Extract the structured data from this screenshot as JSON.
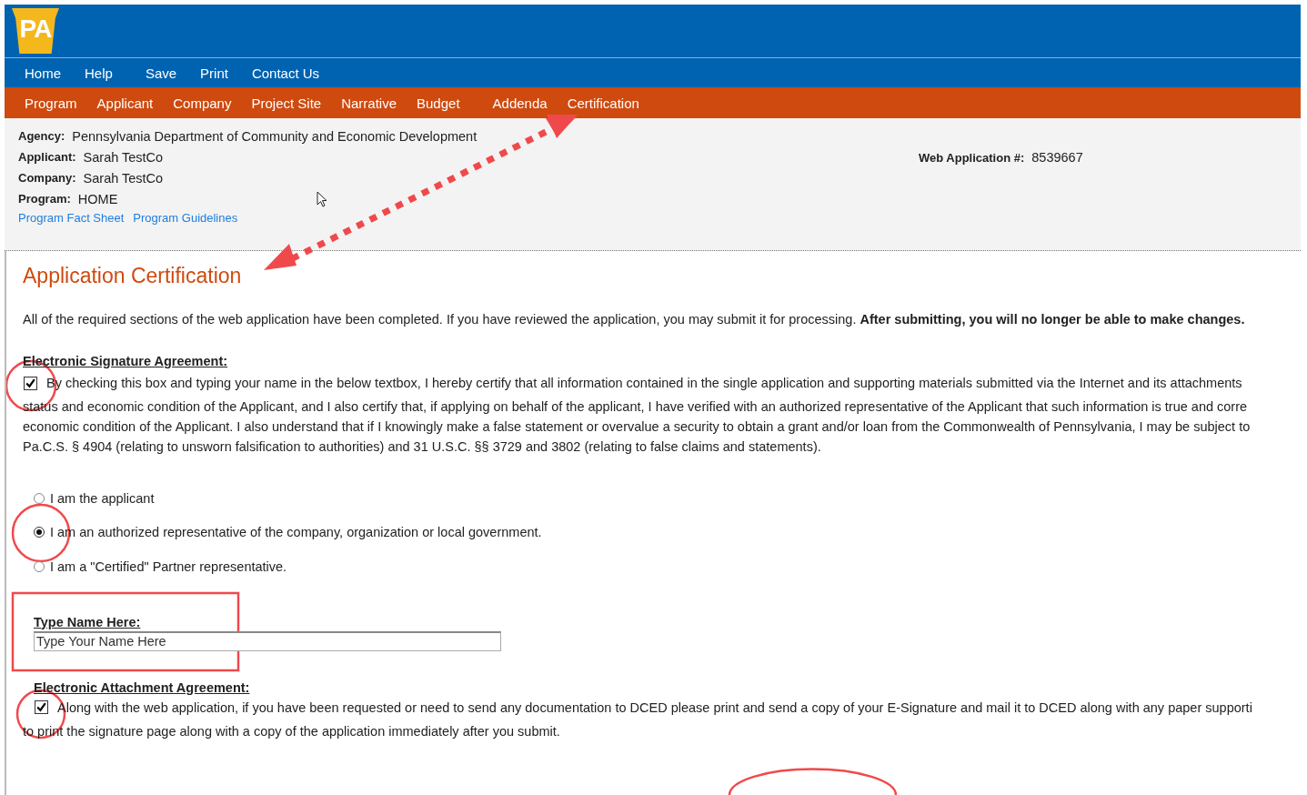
{
  "header": {
    "logo": "PA"
  },
  "top_nav": [
    "Home",
    "Help",
    "Save",
    "Print",
    "Contact Us"
  ],
  "section_tabs": [
    "Program",
    "Applicant",
    "Company",
    "Project Site",
    "Narrative",
    "Budget",
    "Addenda",
    "Certification"
  ],
  "info": {
    "fields": [
      {
        "label": "Agency:",
        "value": "Pennsylvania Department of Community and Economic Development"
      },
      {
        "label": "Applicant:",
        "value": "Sarah TestCo"
      },
      {
        "label": "Company:",
        "value": "Sarah TestCo"
      },
      {
        "label": "Program:",
        "value": "HOME"
      }
    ],
    "links": [
      "Program Fact Sheet",
      "Program Guidelines"
    ],
    "web_application": {
      "label": "Web Application #:",
      "value": "8539667"
    }
  },
  "page_title": "Application Certification",
  "intro": "All of the required sections of the web application have been completed.  If you have reviewed the application, you may submit it for processing. **After submitting, you will no longer be able to make changes.**",
  "signature_agreement": {
    "heading": "Electronic Signature Agreement:",
    "checked": true,
    "lines": [
      "By checking this box and typing your name in the below textbox, I hereby certify that all information contained in the single application and supporting materials submitted via the Internet and its attachments",
      "status and economic condition of the Applicant, and I also certify that, if applying on behalf of the applicant, I have verified with an authorized representative of the Applicant that such information is true and corre",
      "economic condition of the Applicant. I also understand that if I knowingly make a false statement or overvalue a security to obtain a grant and/or loan from the Commonwealth of Pennsylvania, I may be subject to",
      "Pa.C.S. § 4904 (relating to unsworn falsification to authorities) and 31 U.S.C. §§ 3729 and 3802 (relating to false claims and statements)."
    ]
  },
  "role_options": [
    {
      "label": "I am the applicant",
      "selected": false
    },
    {
      "label": "I am an authorized representative of the company, organization or local government.",
      "selected": true
    },
    {
      "label": "I am a \"Certified\" Partner representative.",
      "selected": false
    }
  ],
  "name_field": {
    "label": "Type Name Here:",
    "placeholder": "Type Your Name Here"
  },
  "attachment_agreement": {
    "heading": "Electronic Attachment Agreement:",
    "checked": true,
    "lines": [
      "Along with the web application, if you have been requested or need to send any documentation to DCED please print and send a copy of your E-Signature and mail it to DCED along with any paper supporti",
      "to print the signature page along with a copy of the application immediately after you submit."
    ]
  }
}
